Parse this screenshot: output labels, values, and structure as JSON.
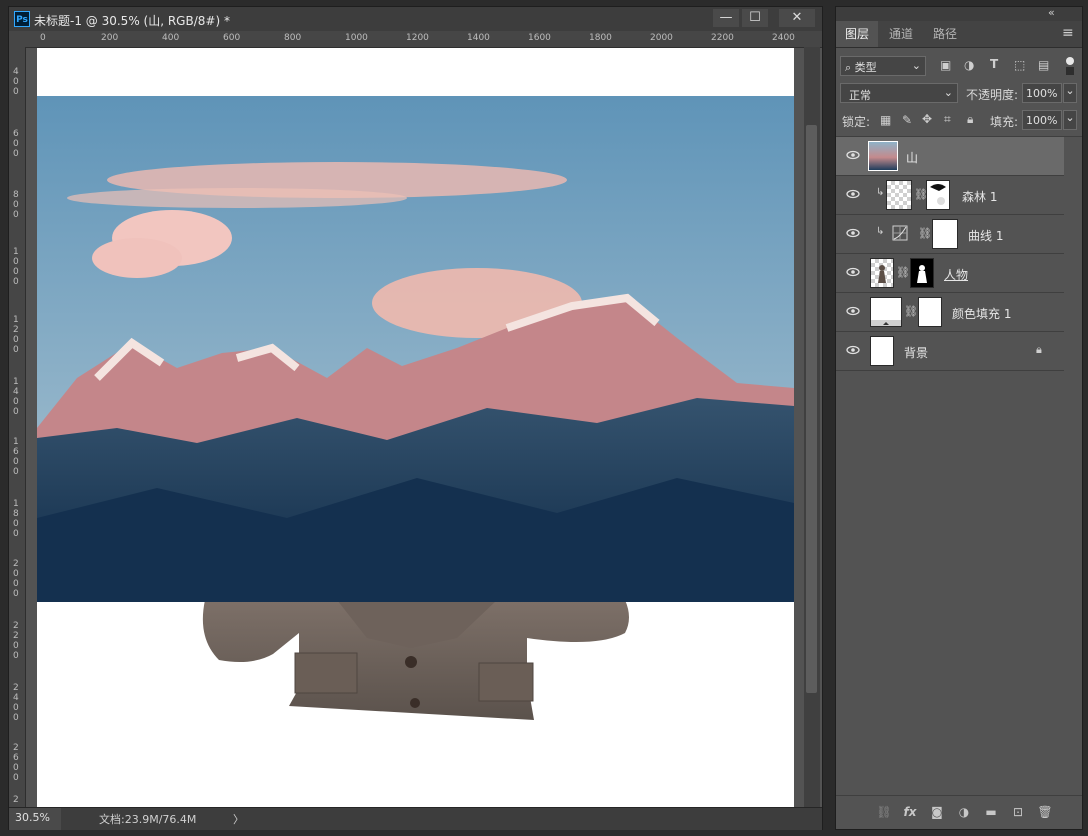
{
  "document": {
    "title": "未标题-1 @ 30.5% (山, RGB/8#) *",
    "app_badge": "Ps",
    "window_buttons": [
      "—",
      "☐",
      "✕"
    ],
    "ruler_top": [
      "0",
      "200",
      "400",
      "600",
      "800",
      "1000",
      "1200",
      "1400",
      "1600",
      "1800",
      "2000",
      "2200",
      "2400"
    ],
    "ruler_left": [
      "4\n0\n0",
      "6\n0\n0",
      "8\n0\n0",
      "1\n0\n0\n0",
      "1\n2\n0\n0",
      "1\n4\n0\n0",
      "1\n6\n0\n0",
      "1\n8\n0\n0",
      "2\n0\n0\n0",
      "2\n2\n0\n0",
      "2\n4\n0\n0",
      "2\n6\n0\n0",
      "2"
    ],
    "zoom": "30.5%",
    "doc_info": "文档:23.9M/76.4M",
    "status_arrow": "〉"
  },
  "panel": {
    "collapse": "«",
    "tabs": [
      "图层",
      "通道",
      "路径"
    ],
    "active_tab": 0,
    "menu_icon": "≡",
    "filter_kind": "类型",
    "blend_mode": "正常",
    "opacity_label": "不透明度:",
    "opacity": "100%",
    "lock_label": "锁定:",
    "fill_label": "填充:",
    "fill": "100%",
    "layers": [
      {
        "name": "山",
        "selected": true
      },
      {
        "name": "森林 1",
        "selected": false
      },
      {
        "name": "曲线 1",
        "selected": false
      },
      {
        "name": "人物",
        "selected": false
      },
      {
        "name": "颜色填充 1",
        "selected": false
      },
      {
        "name": "背景",
        "selected": false
      }
    ],
    "bottom_icons": [
      "link-icon",
      "fx-icon",
      "mask-icon",
      "adjustment-icon",
      "folder-icon",
      "new-layer-icon",
      "trash-icon"
    ]
  },
  "colors": {
    "accent": "#31a8ff",
    "panel_bg": "#535353",
    "selected_layer": "#6a6a6a"
  }
}
